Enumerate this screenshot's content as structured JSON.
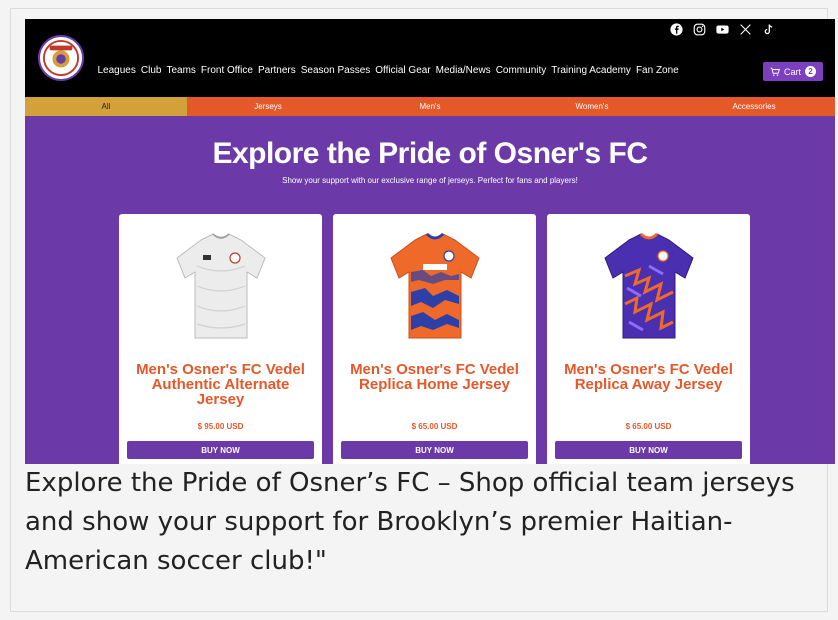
{
  "header": {
    "nav_items": [
      "Leagues",
      "Club",
      "Teams",
      "Front Office",
      "Partners",
      "Season Passes",
      "Official Gear",
      "Media/News",
      "Community",
      "Training Academy",
      "Fan Zone"
    ],
    "cart_label": "Cart",
    "cart_count": "2",
    "social_icons": [
      "facebook-icon",
      "instagram-icon",
      "youtube-icon",
      "x-icon",
      "tiktok-icon"
    ]
  },
  "categories": [
    "All",
    "Jerseys",
    "Men's",
    "Women's",
    "Accessories"
  ],
  "hero": {
    "title": "Explore the Pride of Osner's FC",
    "subtitle": "Show your support with our exclusive range of jerseys. Perfect for fans and players!"
  },
  "products": [
    {
      "name": "Men's Osner's FC Vedel Authentic Alternate Jersey",
      "price": "$ 95.00 USD",
      "button": "BUY NOW"
    },
    {
      "name": "Men's Osner's FC Vedel Replica Home Jersey",
      "price": "$ 65.00 USD",
      "button": "BUY NOW"
    },
    {
      "name": "Men's Osner's FC Vedel Replica Away Jersey",
      "price": "$ 65.00 USD",
      "button": "BUY NOW"
    }
  ],
  "caption": "Explore the Pride of Osner’s FC – Shop official team jerseys and show your support for Brooklyn’s premier Haitian-American soccer club!\"",
  "colors": {
    "purple": "#6b3aa8",
    "orange": "#e5582a",
    "gold": "#d2a13a",
    "black": "#000000"
  }
}
